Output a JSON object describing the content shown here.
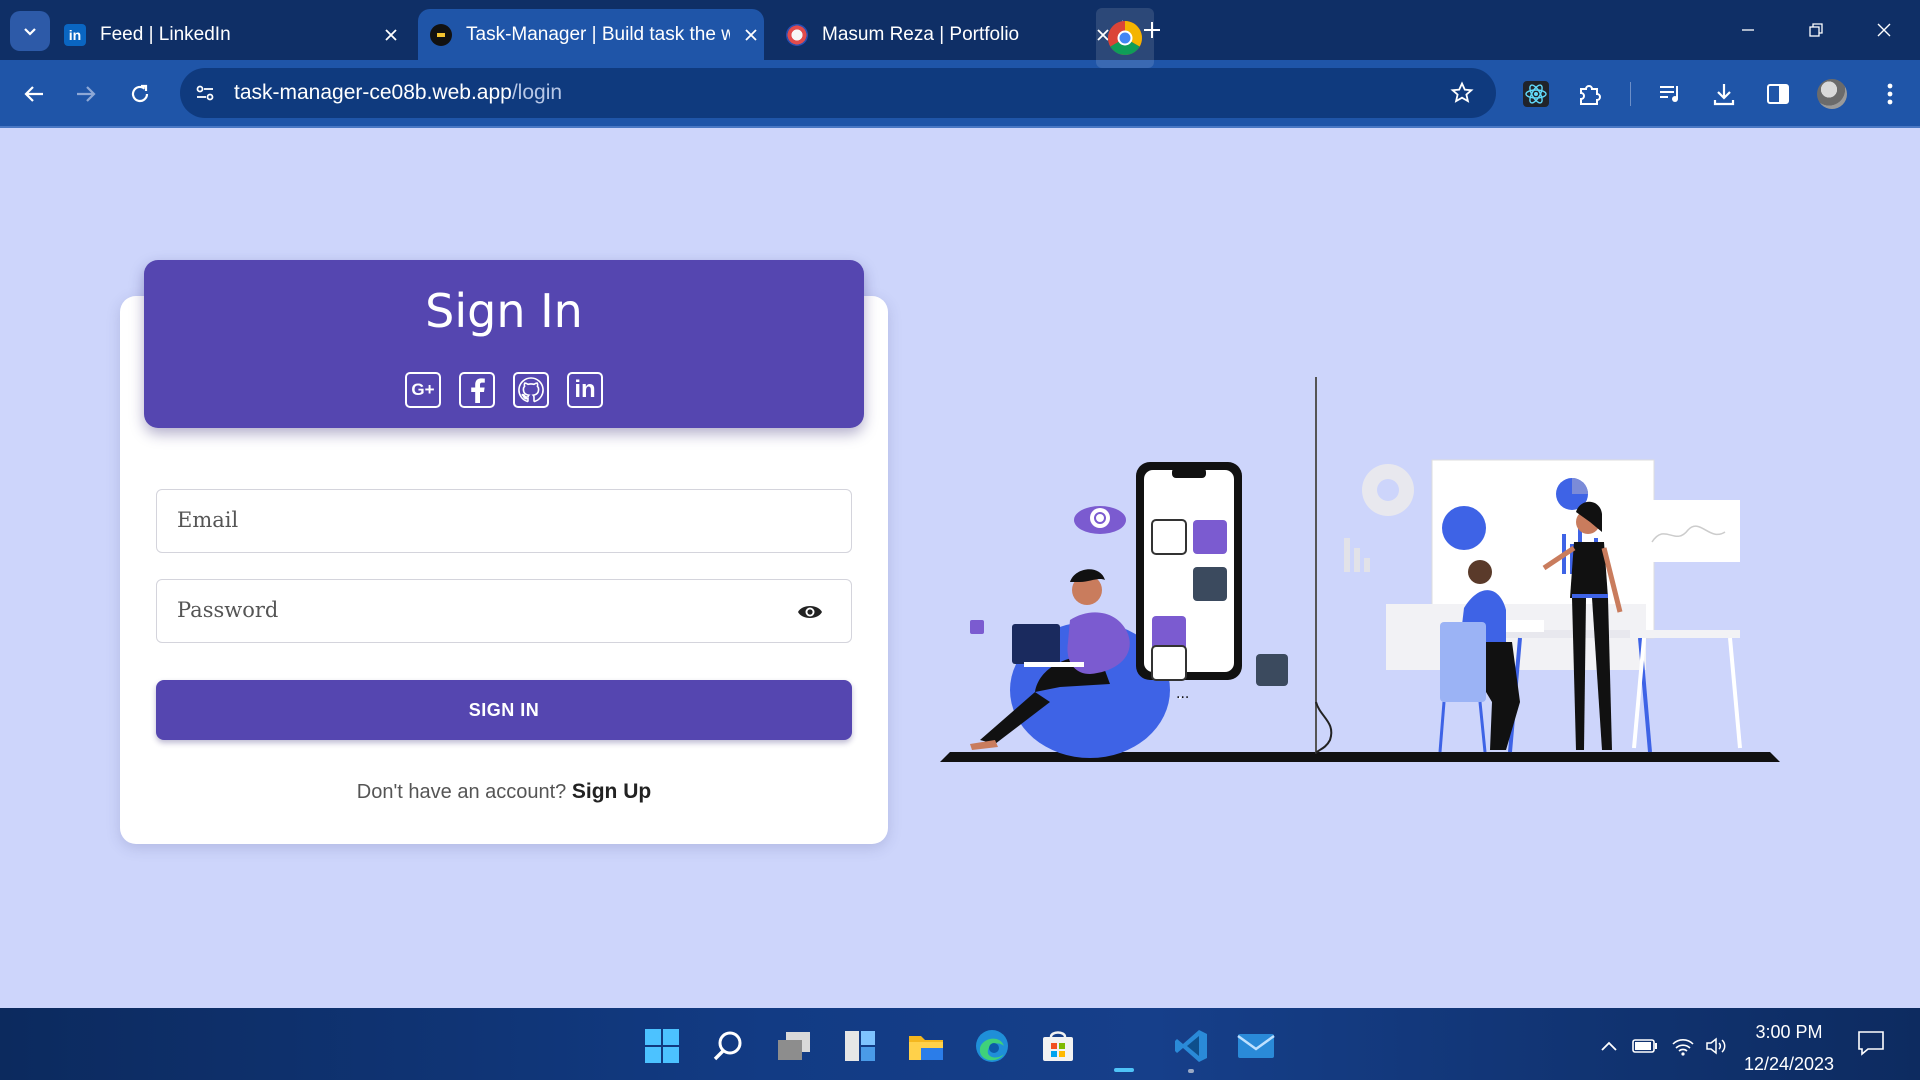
{
  "browser": {
    "tabs": [
      {
        "title": "Feed | LinkedIn",
        "favicon": "linkedin-icon",
        "active": false
      },
      {
        "title": "Task-Manager | Build task the w",
        "favicon": "task-manager-icon",
        "active": true
      },
      {
        "title": "Masum Reza | Portfolio",
        "favicon": "portfolio-icon",
        "active": false
      }
    ],
    "url_host": "task-manager-ce08b.web.app",
    "url_path": "/login"
  },
  "page": {
    "heading": "Sign In",
    "social": [
      "G+",
      "facebook-icon",
      "github-icon",
      "in"
    ],
    "email_placeholder": "Email",
    "password_placeholder": "Password",
    "signin_button": "SIGN IN",
    "signup_prompt": "Don't have an account?",
    "signup_link": "Sign Up"
  },
  "colors": {
    "background": "#cdd5fb",
    "primary": "#5546b0",
    "chrome": "#1f55a8"
  },
  "taskbar": {
    "apps": [
      "windows-start-icon",
      "search-icon",
      "task-view-icon",
      "widgets-icon",
      "file-explorer-icon",
      "edge-icon",
      "store-icon",
      "chrome-icon",
      "vscode-icon",
      "mail-icon"
    ],
    "time": "3:00 PM",
    "date": "12/24/2023"
  }
}
